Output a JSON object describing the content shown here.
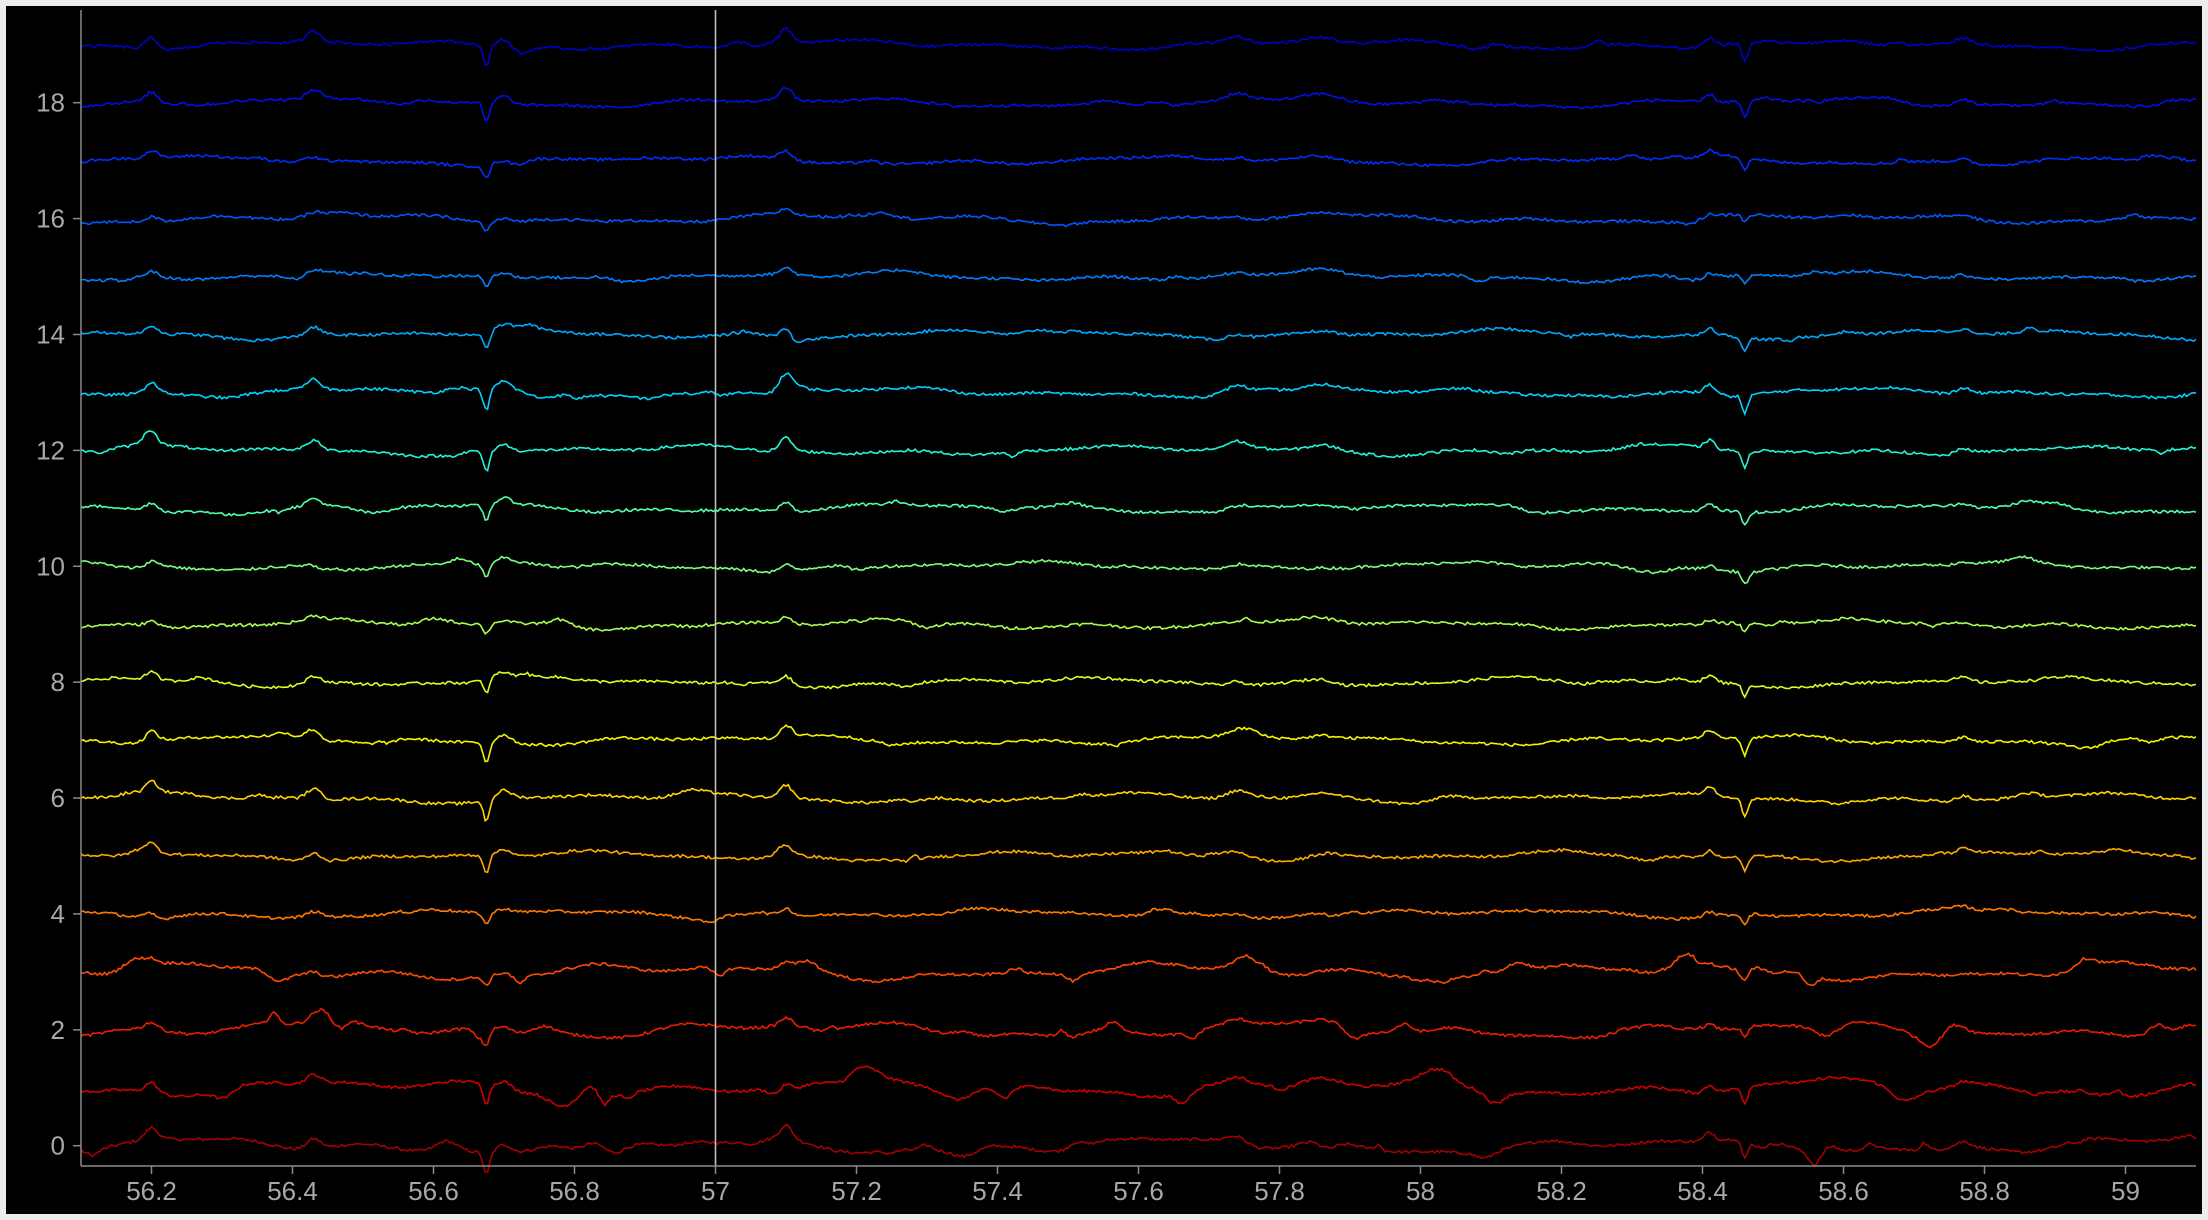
{
  "chart_data": {
    "type": "line",
    "title": "",
    "xlabel": "",
    "ylabel": "",
    "xlim": [
      56.1,
      59.1
    ],
    "ylim": [
      -0.35,
      19.6
    ],
    "x_ticks": [
      56.2,
      56.4,
      56.6,
      56.8,
      57,
      57.2,
      57.4,
      57.6,
      57.8,
      58,
      58.2,
      58.4,
      58.6,
      58.8,
      59
    ],
    "x_tick_labels": [
      "56.2",
      "56.4",
      "56.6",
      "56.8",
      "57",
      "57.2",
      "57.4",
      "57.6",
      "57.8",
      "58",
      "58.2",
      "58.4",
      "58.6",
      "58.8",
      "59"
    ],
    "y_ticks": [
      0,
      2,
      4,
      6,
      8,
      10,
      12,
      14,
      16,
      18
    ],
    "y_tick_labels": [
      "0",
      "2",
      "4",
      "6",
      "8",
      "10",
      "12",
      "14",
      "16",
      "18"
    ],
    "grid": false,
    "legend": "none",
    "cursor_x": 57.0,
    "background": "#000000",
    "channel_offsets": [
      0,
      1,
      2,
      3,
      4,
      5,
      6,
      7,
      8,
      9,
      10,
      11,
      12,
      13,
      14,
      15,
      16,
      17,
      18,
      19
    ],
    "channel_colors": [
      "#a50000",
      "#cc0000",
      "#ee1c00",
      "#ff4a00",
      "#ff7a00",
      "#ffa800",
      "#ffd400",
      "#f4f400",
      "#d4ff22",
      "#a8ff50",
      "#7aff7e",
      "#50ffac",
      "#22f4d8",
      "#00d2ff",
      "#00a8ff",
      "#007eff",
      "#0056ff",
      "#002eff",
      "#0010e8",
      "#0000c8"
    ],
    "common_events": [
      {
        "x": 56.2,
        "amp": 0.2,
        "width": 0.012
      },
      {
        "x": 56.43,
        "amp": 0.18,
        "width": 0.014
      },
      {
        "x": 56.675,
        "amp": -0.38,
        "width": 0.006
      },
      {
        "x": 56.7,
        "amp": 0.15,
        "width": 0.014
      },
      {
        "x": 57.1,
        "amp": 0.24,
        "width": 0.012
      },
      {
        "x": 57.74,
        "amp": 0.12,
        "width": 0.02
      },
      {
        "x": 57.86,
        "amp": 0.1,
        "width": 0.03
      },
      {
        "x": 58.41,
        "amp": 0.15,
        "width": 0.01
      },
      {
        "x": 58.46,
        "amp": -0.32,
        "width": 0.006
      },
      {
        "x": 58.77,
        "amp": 0.1,
        "width": 0.015
      }
    ]
  }
}
